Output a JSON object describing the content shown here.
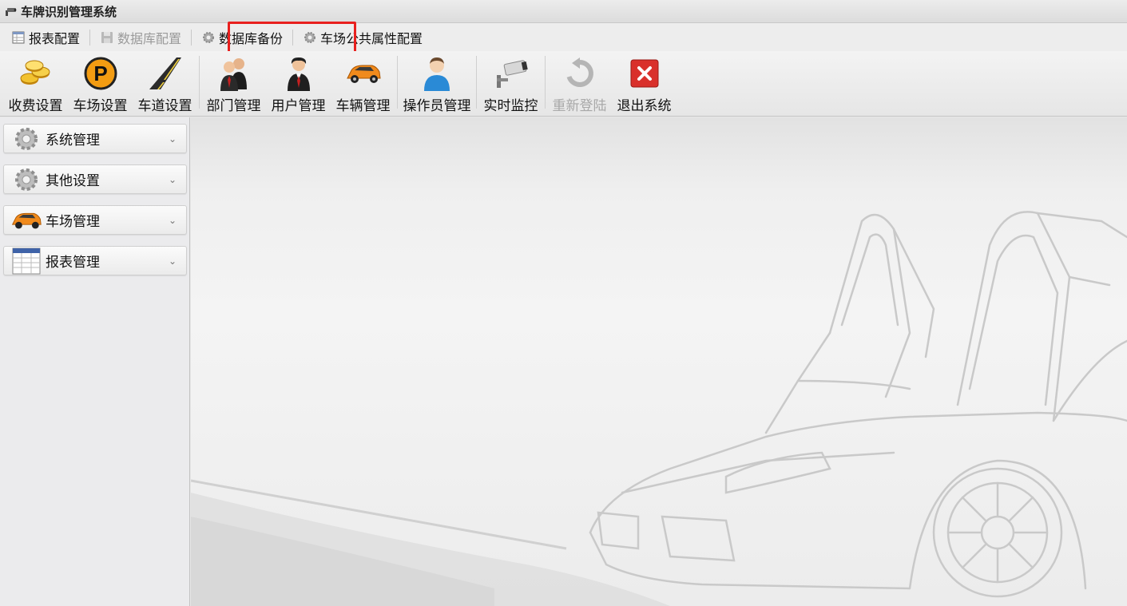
{
  "window": {
    "title": "车牌识别管理系统"
  },
  "menu": {
    "report_config": "报表配置",
    "db_config": "数据库配置",
    "db_backup": "数据库备份",
    "lot_public_config": "车场公共属性配置"
  },
  "toolbar": {
    "fee_settings": "收费设置",
    "lot_settings": "车场设置",
    "lane_settings": "车道设置",
    "dept_mgmt": "部门管理",
    "user_mgmt": "用户管理",
    "vehicle_mgmt": "车辆管理",
    "operator_mgmt": "操作员管理",
    "live_monitor": "实时监控",
    "relogin": "重新登陆",
    "exit": "退出系统"
  },
  "sidebar": {
    "items": [
      {
        "label": "系统管理",
        "icon": "gear-icon"
      },
      {
        "label": "其他设置",
        "icon": "gear-icon"
      },
      {
        "label": "车场管理",
        "icon": "car-icon"
      },
      {
        "label": "报表管理",
        "icon": "table-icon"
      }
    ]
  },
  "colors": {
    "highlight": "#e8201e",
    "exit_red": "#d9302b",
    "parking_orange": "#f39c12",
    "operator_blue": "#2a8ad6"
  }
}
